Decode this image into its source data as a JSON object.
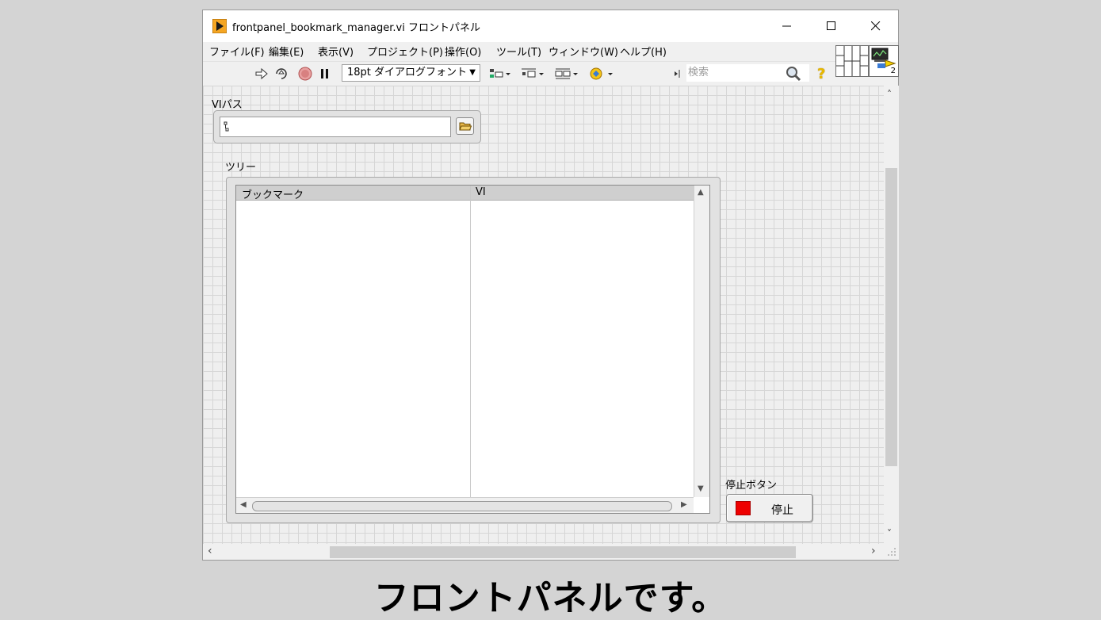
{
  "window": {
    "title": "frontpanel_bookmark_manager.vi フロントパネル",
    "minimize": "—",
    "maximize": "☐",
    "close": "✕"
  },
  "menu": [
    {
      "label": "ファイル(F)"
    },
    {
      "label": "編集(E)"
    },
    {
      "label": "表示(V)"
    },
    {
      "label": "プロジェクト(P)"
    },
    {
      "label": "操作(O)"
    },
    {
      "label": "ツール(T)"
    },
    {
      "label": "ウィンドウ(W)"
    },
    {
      "label": "ヘルプ(H)"
    }
  ],
  "toolbar": {
    "font": "18pt ダイアログフォント",
    "search_placeholder": "検索",
    "help_glyph": "?"
  },
  "panel": {
    "path_label": "VIパス",
    "path_value": "",
    "tree_label": "ツリー",
    "tree_columns": [
      "ブックマーク",
      "VI"
    ],
    "stop_label": "停止ボタン",
    "stop_text": "停止"
  },
  "vi_icon_number": "2",
  "caption": "フロントパネルです。",
  "colors": {
    "stop_led": "#ee0000",
    "labview_icon": "#f5a623"
  }
}
